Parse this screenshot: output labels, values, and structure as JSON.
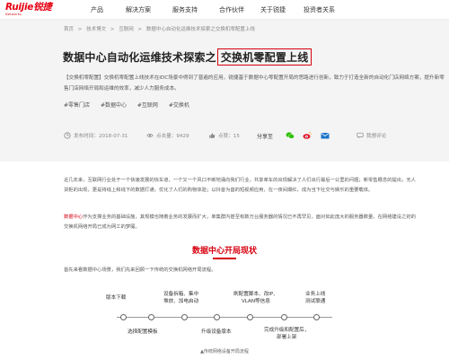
{
  "brand": {
    "logo_text": "Ruijie锐捷",
    "logo_sub": "Networks",
    "color": "#e60012"
  },
  "nav": [
    "产品",
    "解决方案",
    "服务支持",
    "合作伙伴",
    "关于锐捷",
    "投资者关系"
  ],
  "breadcrumb": [
    "首页",
    ">",
    "技术博文",
    ">",
    "互联网",
    ">",
    "数据中心自动化运维技术探索之交换机零配置上线"
  ],
  "article": {
    "title_prefix": "数据中心自动化运维技术探索之",
    "title_highlight": "交换机零配置上线",
    "summary": "【交换机零配置】交换机零配置上线技术在IDC场景中得到了普遍的应用，锐捷基于数据中心零配置开局的思路进行创新，致力于打造全新的自动化门店网络方案，提升新零售门店网络开局和运维的效率，减少人力服务成本。",
    "tags": [
      "#零售门店",
      "#数据中心",
      "#互联网",
      "#交换机"
    ],
    "meta": {
      "date_label": "发布时间：2018-07-31",
      "views_label": "点击量：9429",
      "likes_label": "点赞：15",
      "share_label": "分享至",
      "comment_label": "我想评论"
    }
  },
  "body": {
    "para1": "近几年来，互联网行业处于一个快速发展的快车道，一个又一个风口不断地涌向我们行业，共享单车的出现解决了人们出行最后一公里的问题；新零售概念的提出，无人货柜的出现，更是将线上和线下的数据打通，优化了人们的购物体验；以抖音为首的短视频应用，在一夜间爆红，成为当下社交与娱乐的重要载体。",
    "para2_link": "数据中心",
    "para2": "作为支撑业务的基础设施，其规模也随着业务的发展而扩大，单集群内甚至有数万台服务器的情况已不再罕见，面对如此庞大的服务器数量，在网络建设之初的交换机网络开局已成为网工的梦魇。",
    "section_title": "数据中心开局现状",
    "lead": "首先来看数据中心场景，我们先来回顾一下传统的交换机网络开局流程。",
    "timeline_top": [
      "版本下载",
      "设备拆箱、集中\n堆放、加电启动",
      "刷配置脚本、改IP、\nVLAN等信息",
      "业务上线\n测试联通"
    ],
    "timeline_bottom": [
      "选择配置模板",
      "升级设备版本",
      "完成升级和配置后，\n部署上架"
    ],
    "caption": "▲传统网络设备开局流程"
  }
}
